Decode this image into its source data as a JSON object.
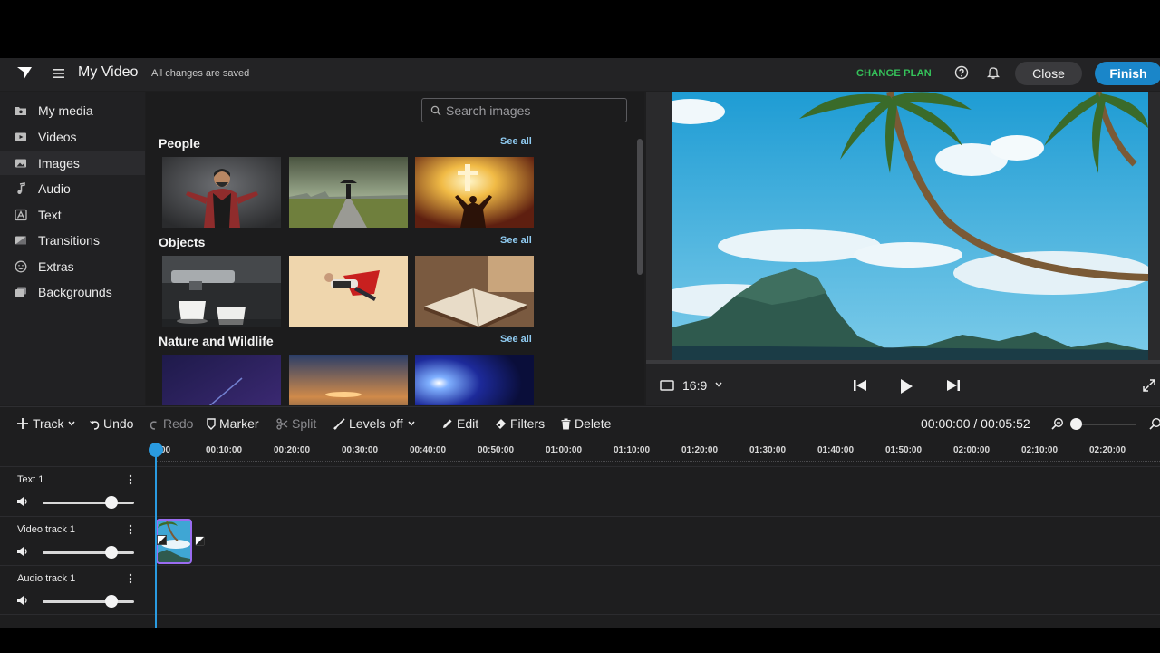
{
  "header": {
    "title": "My Video",
    "save_status": "All changes are saved",
    "change_plan": "CHANGE PLAN",
    "close_label": "Close",
    "finish_label": "Finish"
  },
  "sidebar": {
    "items": [
      {
        "label": "My media",
        "icon": "folder-icon"
      },
      {
        "label": "Videos",
        "icon": "video-icon"
      },
      {
        "label": "Images",
        "icon": "image-icon"
      },
      {
        "label": "Audio",
        "icon": "music-note-icon"
      },
      {
        "label": "Text",
        "icon": "text-icon"
      },
      {
        "label": "Transitions",
        "icon": "transitions-icon"
      },
      {
        "label": "Extras",
        "icon": "smiley-icon"
      },
      {
        "label": "Backgrounds",
        "icon": "backgrounds-icon"
      }
    ],
    "active": "Images"
  },
  "library": {
    "search_placeholder": "Search images",
    "see_all": "See all",
    "categories": [
      {
        "title": "People"
      },
      {
        "title": "Objects"
      },
      {
        "title": "Nature and Wildlife"
      }
    ]
  },
  "preview": {
    "aspect_ratio": "16:9"
  },
  "toolbar": {
    "track": "Track",
    "undo": "Undo",
    "redo": "Redo",
    "marker": "Marker",
    "split": "Split",
    "levels": "Levels off",
    "edit": "Edit",
    "filters": "Filters",
    "delete": "Delete",
    "timecode": "00:00:00 / 00:05:52"
  },
  "timeline": {
    "ticks": [
      "00",
      "00:10:00",
      "00:20:00",
      "00:30:00",
      "00:40:00",
      "00:50:00",
      "01:00:00",
      "01:10:00",
      "01:20:00",
      "01:30:00",
      "01:40:00",
      "01:50:00",
      "02:00:00",
      "02:10:00",
      "02:20:00"
    ],
    "tracks": [
      {
        "name": "Text 1"
      },
      {
        "name": "Video track 1"
      },
      {
        "name": "Audio track 1"
      }
    ]
  },
  "colors": {
    "accent": "#1a86c9",
    "change_plan": "#35c25a",
    "playhead": "#2a9be0",
    "clip_border": "#9a6cf0"
  }
}
